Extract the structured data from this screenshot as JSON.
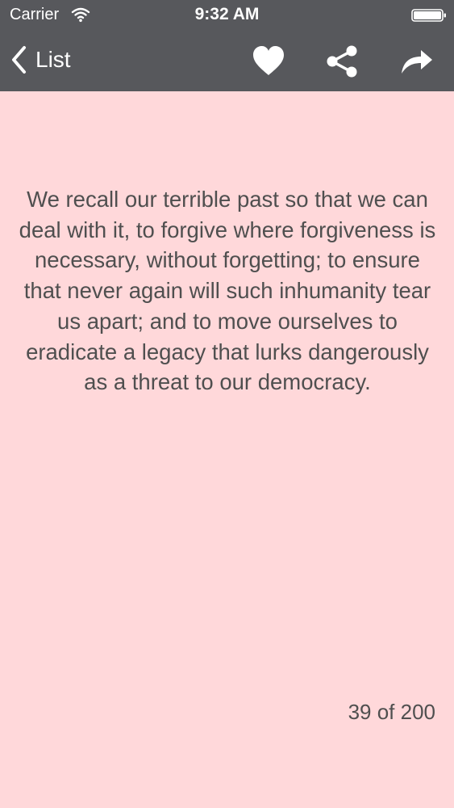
{
  "status_bar": {
    "carrier": "Carrier",
    "time": "9:32 AM",
    "icons": [
      "wifi-icon",
      "battery-icon"
    ]
  },
  "nav_bar": {
    "back_label": "List",
    "icons": [
      "chevron-left-icon",
      "heart-icon",
      "share-icon",
      "forward-arrow-icon"
    ]
  },
  "quote": {
    "text": "We recall our terrible past so that we can deal with it, to forgive where forgiveness is necessary, without forgetting; to ensure that never again will such inhumanity tear us apart; and to move ourselves to eradicate a legacy that lurks dangerously as a threat to our democracy."
  },
  "pager": {
    "counter": "39 of 200"
  },
  "colors": {
    "nav_background": "#57585c",
    "page_background": "#ffd8da",
    "text": "#4f4f4f",
    "icon": "#ffffff"
  }
}
